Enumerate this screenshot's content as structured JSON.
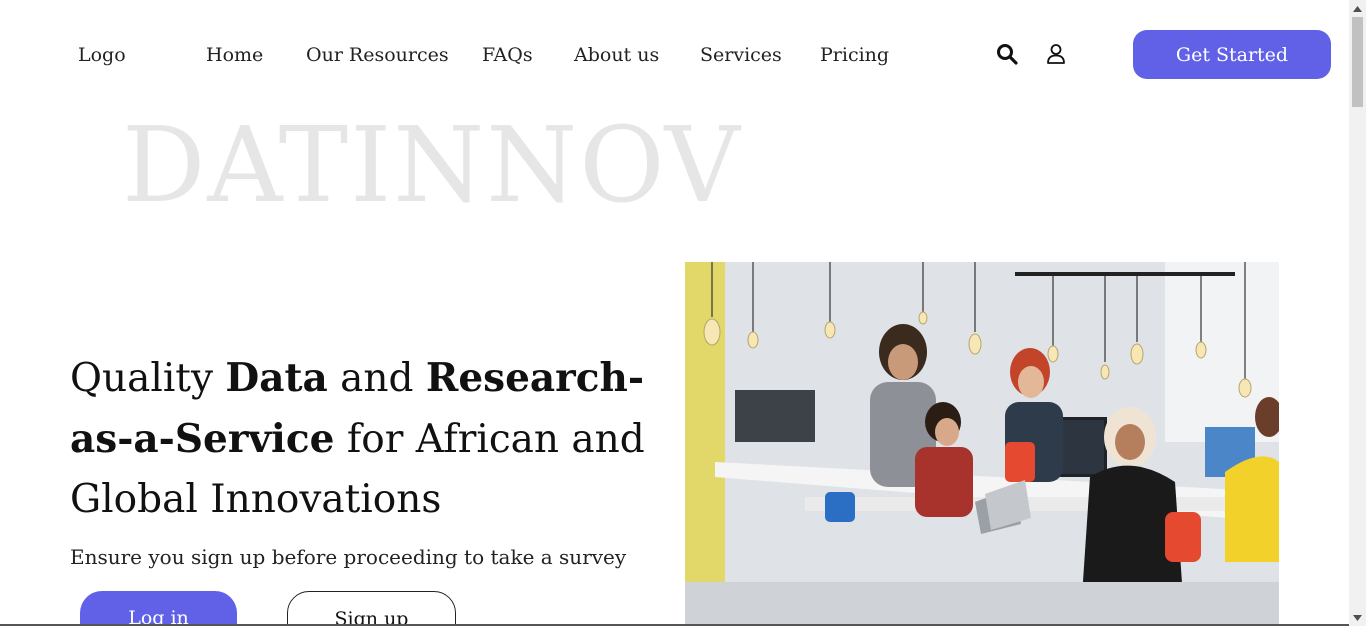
{
  "nav": {
    "logo": "Logo",
    "items": [
      {
        "label": "Home"
      },
      {
        "label": "Our Resources"
      },
      {
        "label": "FAQs"
      },
      {
        "label": "About us"
      },
      {
        "label": "Services"
      },
      {
        "label": "Pricing"
      }
    ],
    "search_icon": "search-icon",
    "user_icon": "user-icon",
    "cta_label": "Get Started"
  },
  "hero": {
    "watermark": "DATINNOV",
    "headline_parts": [
      {
        "text": "Quality ",
        "bold": false
      },
      {
        "text": "Data",
        "bold": true
      },
      {
        "text": " and ",
        "bold": false
      },
      {
        "text": "Research-as-a-Service",
        "bold": true
      },
      {
        "text": " for African and Global Innovations",
        "bold": false
      }
    ],
    "subtext": "Ensure you sign up before proceeding to take a survey",
    "login_label": "Log in",
    "signup_label": "Sign up",
    "image_icon": "office-team-photo"
  },
  "colors": {
    "accent": "#6161e8",
    "watermark": "#e6e6e6",
    "text": "#1a1a1a"
  }
}
